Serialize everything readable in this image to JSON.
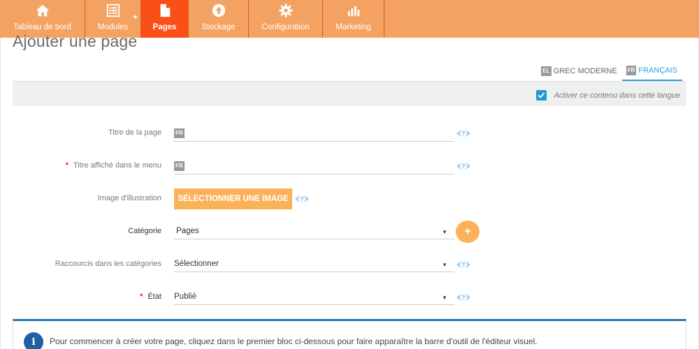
{
  "nav": {
    "items": [
      {
        "label": "Tableau de bord",
        "icon": "home-icon"
      },
      {
        "label": "Modules",
        "icon": "list-icon"
      },
      {
        "label": "Pages",
        "icon": "page-icon",
        "active": true
      },
      {
        "label": "Stockage",
        "icon": "upload-icon"
      },
      {
        "label": "Configuration",
        "icon": "gear-icon"
      },
      {
        "label": "Marketing",
        "icon": "bar-chart-icon"
      }
    ],
    "colors": {
      "bar": "#f4a261",
      "active": "#fa4f16"
    }
  },
  "page": {
    "title": "Ajouter une page"
  },
  "languages": {
    "tabs": [
      {
        "code": "EL",
        "label": "GREC MODERNE",
        "active": false
      },
      {
        "code": "FR",
        "label": "FRANÇAIS",
        "active": true
      }
    ],
    "activate_label": "Activer ce contenu dans cette langue",
    "activate_checked": true
  },
  "form": {
    "page_title": {
      "label": "Titre de la page",
      "lang": "FR",
      "value": ""
    },
    "menu_title": {
      "label": "Titre affiché dans le menu",
      "lang": "FR",
      "value": "",
      "required": "*"
    },
    "image": {
      "label": "Image d'illustration",
      "button": "SÉLECTIONNER UNE IMAGE"
    },
    "category": {
      "label": "Catégorie",
      "selected": "Pages",
      "add": "+"
    },
    "shortcuts": {
      "label": "Raccourcis dans les catégories",
      "selected": "Sélectionner"
    },
    "state": {
      "label": "État",
      "selected": "Publié",
      "required": "*"
    }
  },
  "info": {
    "icon": "i",
    "text": "Pour commencer à créer votre page, cliquez dans le premier bloc ci-dessous pour faire apparaître la barre d'outil de l'éditeur visuel."
  },
  "accent_colors": {
    "orange_button": "#fab25a",
    "blue": "#27a1d8",
    "info_blue": "#1f5fa3"
  }
}
